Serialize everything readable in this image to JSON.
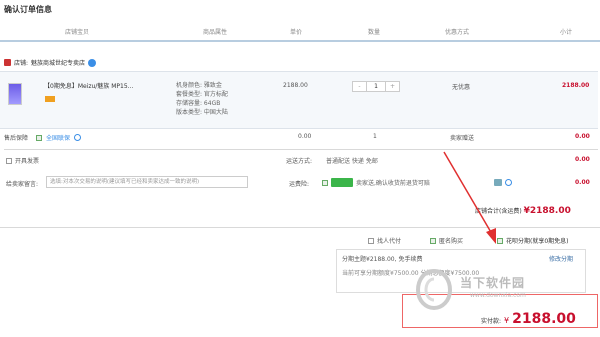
{
  "title": "确认订单信息",
  "columns": [
    "店铺宝贝",
    "商品属性",
    "单价",
    "数量",
    "优惠方式",
    "小计"
  ],
  "store": {
    "label": "店铺:",
    "name": "魅族商城世纪专卖店"
  },
  "item": {
    "name": "【0期免息】Meizu/魅族 MP15...",
    "specs": [
      "机身颜色: 雅致金",
      "套餐类型: 官方标配",
      "存储容量: 64GB",
      "版本类型: 中国大陆"
    ],
    "price": "2188.00",
    "qty": "1",
    "minus": "-",
    "plus": "+",
    "discount": "无优惠",
    "subtotal": "2188.00"
  },
  "service": {
    "label": "售后保障",
    "option": "全国联保",
    "price": "0.00",
    "qty": "1",
    "discount": "卖家赠送",
    "subtotal": "0.00"
  },
  "invoice": {
    "label": "开具发票",
    "shipping_label": "运送方式:",
    "shipping_value": "普通配送 快递 免邮",
    "subtotal": "0.00"
  },
  "message": {
    "label": "给卖家留言:",
    "placeholder": "选填:对本次交易的说明(建议填写已经和卖家达成一致的说明)"
  },
  "freight": {
    "label": "运费险:",
    "text": "卖家送,确认收货前退货可赔",
    "subtotal": "0.00"
  },
  "store_total": {
    "label": "店铺合计(含运费)",
    "value": "¥2188.00"
  },
  "options": {
    "proxy": "找人代付",
    "anonymous": "匿名购买",
    "installment": "花呗分期(就享0期免息)"
  },
  "installment": {
    "line1": "分期主题¥2188.00, 免手续费",
    "modify": "修改分期",
    "line2": "当前可享分期额度¥7500.00 分期总额度¥7500.00"
  },
  "pay": {
    "label": "实付款:",
    "currency": "¥",
    "amount": "2188.00"
  },
  "watermark": {
    "name": "当下软件园",
    "url": "www.downxia.com"
  },
  "colors": {
    "price_red": "#c8102e",
    "accent_blue": "#3a8ee6",
    "arrow_red": "#e03030"
  }
}
